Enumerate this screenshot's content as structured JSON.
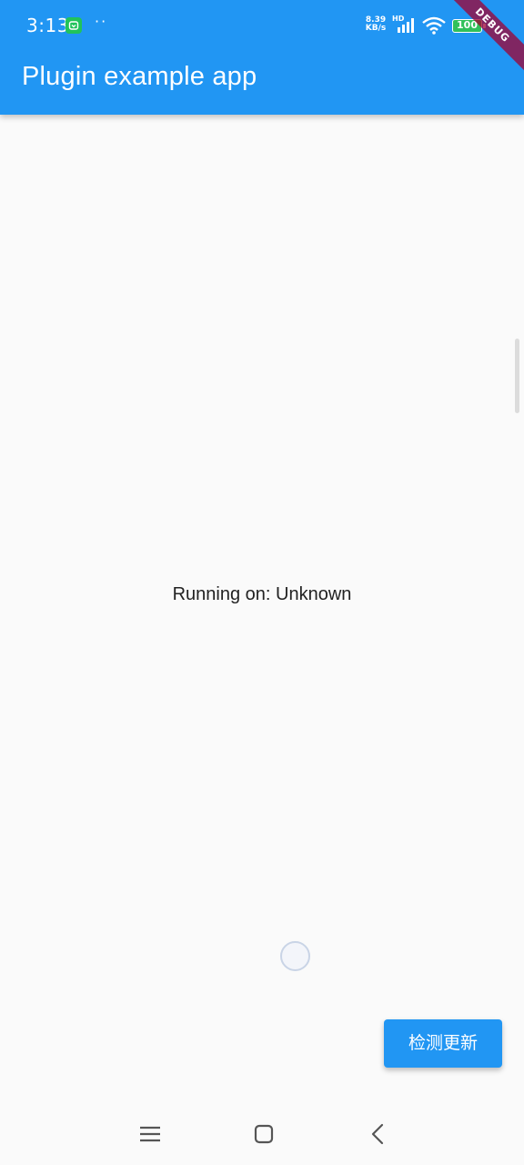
{
  "status_bar": {
    "time": "3:13",
    "dots": "··",
    "net_speed_value": "8.39",
    "net_speed_unit": "KB/s",
    "hd_label": "HD",
    "battery": "100",
    "icons": [
      "notification-icon",
      "signal-icon",
      "wifi-icon",
      "battery-icon"
    ]
  },
  "app_bar": {
    "title": "Plugin example app"
  },
  "debug_banner": "DEBUG",
  "body": {
    "platform_text": "Running on: Unknown"
  },
  "fab": {
    "label": "检测更新"
  },
  "nav_bar": {
    "items": [
      "menu-icon",
      "home-icon",
      "back-icon"
    ]
  },
  "colors": {
    "primary": "#2196f3",
    "background": "#fafafa",
    "text": "#222222",
    "battery_fill": "#30c05a",
    "debug_banner": "#a00032"
  }
}
